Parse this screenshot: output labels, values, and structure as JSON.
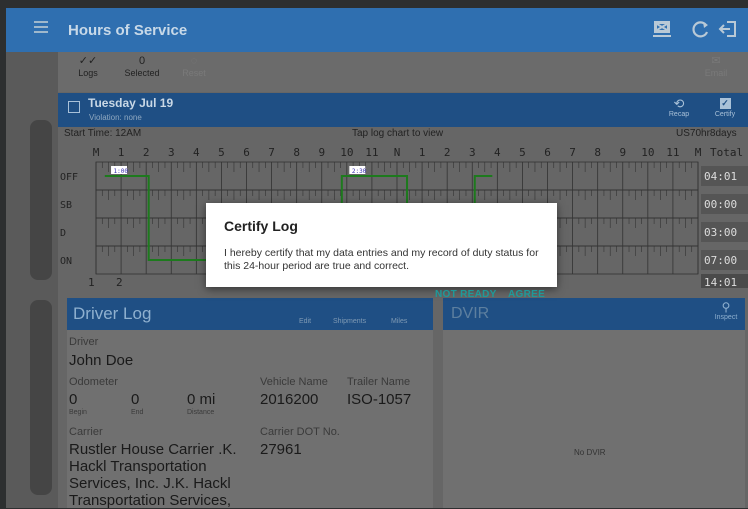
{
  "app": {
    "title": "Hours of Service"
  },
  "toolbar": {
    "logs_label": "Logs",
    "selected_count": "0",
    "selected_label": "Selected",
    "reset_label": "Reset",
    "email_label": "Email"
  },
  "day": {
    "title": "Tuesday Jul 19",
    "violation": "Violation: none",
    "recap_label": "Recap",
    "certify_label": "Certify"
  },
  "log_meta": {
    "start_time": "Start Time: 12AM",
    "hint": "Tap log chart to view",
    "ruleset": "US70hr8days"
  },
  "grid": {
    "hours_top": [
      "M",
      "1",
      "2",
      "3",
      "4",
      "5",
      "6",
      "7",
      "8",
      "9",
      "10",
      "11",
      "N",
      "1",
      "2",
      "3",
      "4",
      "5",
      "6",
      "7",
      "8",
      "9",
      "10",
      "11",
      "M"
    ],
    "total_label": "Total",
    "rows": [
      {
        "label": "OFF",
        "total": "04:01"
      },
      {
        "label": "SB",
        "total": "00:00"
      },
      {
        "label": "D",
        "total": "03:00"
      },
      {
        "label": "ON",
        "total": "07:00"
      }
    ],
    "bottom_labels": [
      "1",
      "2"
    ],
    "grand_total": "14:01",
    "mark_1": "1:00",
    "mark_2": "2:30",
    "mark_3": "7:"
  },
  "driver_log": {
    "title": "Driver Log",
    "edit_label": "Edit",
    "shipments_label": "Shipments",
    "miles_label": "Miles",
    "driver_label": "Driver",
    "driver_name": "John Doe",
    "odometer_label": "Odometer",
    "odo_begin": "0",
    "odo_end": "0",
    "odo_distance": "0 mi",
    "begin_label": "Begin",
    "end_label": "End",
    "distance_label": "Distance",
    "vehicle_label": "Vehicle Name",
    "vehicle_value": "2016200",
    "trailer_label": "Trailer Name",
    "trailer_value": "ISO-1057",
    "carrier_label": "Carrier",
    "carrier_line1": "Rustler House Carrier .K.",
    "carrier_line2": "Hackl Transportation",
    "carrier_line3": "Services, Inc. J.K. Hackl",
    "carrier_line4": "Transportation Services,",
    "dot_label": "Carrier DOT No.",
    "dot_value": "27961"
  },
  "dvir": {
    "title": "DVIR",
    "inspect_label": "Inspect",
    "empty_label": "No DVIR"
  },
  "dialog": {
    "title": "Certify Log",
    "body": "I hereby certify that my data entries and my record of duty status for this 24-hour period are true and correct.",
    "not_ready": "NOT READY",
    "agree": "AGREE"
  },
  "colors": {
    "appbar": "#2f6fb0",
    "header": "#1f4f84",
    "accent_button": "#1e9a9a",
    "graph_line": "#1d7a1d"
  }
}
